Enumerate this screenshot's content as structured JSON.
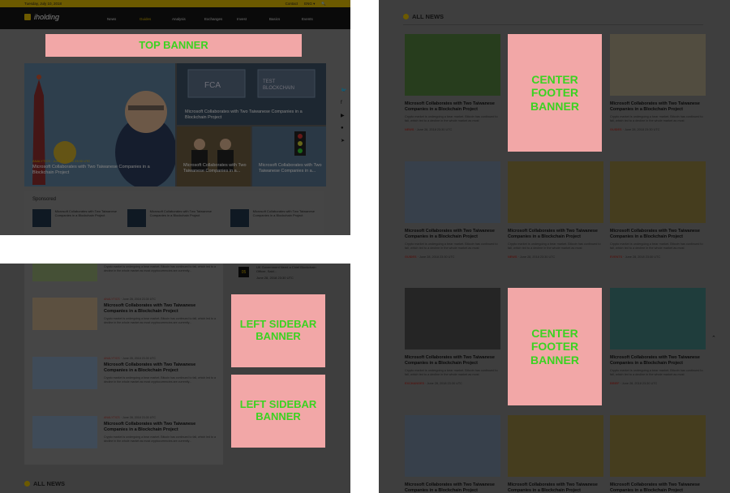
{
  "topbar": {
    "date": "Tuesday, July 10, 2018",
    "links": [
      "Contact",
      "ENG ▾",
      "🔍"
    ]
  },
  "logo": {
    "text": "iholding"
  },
  "nav": {
    "items": [
      "News",
      "Guides",
      "Analysis",
      "Exchanges",
      "Invest",
      "Basics",
      "Events"
    ],
    "active": "Guides"
  },
  "banners": {
    "top": "TOP BANNER",
    "left_sidebar": "LEFT SIDEBAR BANNER",
    "center_footer": "CENTER FOOTER BANNER"
  },
  "hero": {
    "main": {
      "category": "ANALYTICS",
      "date": "June 28, 2018 23:30 UTC",
      "title": "Microsoft Collaborates with Two Taiwanese Companies in a Blockchain Project"
    },
    "top_right": {
      "title": "Microsoft Collaborates with Two Taiwanese Companies in a Blockchain Project"
    },
    "bottom_mid": {
      "title": "Microsoft Collaborates with Two Taiwanese Companies in a..."
    },
    "bottom_right": {
      "title": "Microsoft Collaborates with Two Taiwanese Companies in a..."
    }
  },
  "sponsored": {
    "title": "Sponsored",
    "items": [
      "Microsoft Collaborates with Two Taiwanese Companies in a Blockchain Project",
      "Microsoft Collaborates with Two Taiwanese Companies in a Blockchain Project",
      "Microsoft Collaborates with Two Taiwanese Companies in a Blockchain Project"
    ]
  },
  "social_icons": [
    "twitter-icon",
    "facebook-icon",
    "youtube-icon",
    "reddit-icon",
    "telegram-icon"
  ],
  "left_list": {
    "top_excerpt": "Crypto market is undergoing a bear market. Bitcoin has continued to fall, which led to a decline in the whole market as most cryptocurrencies are currently...",
    "items": [
      {
        "category": "ANALYTICS",
        "date": "June 28, 2018 23:30 UTC",
        "title": "Microsoft Collaborates with Two Taiwanese Companies in a Blockchain Project",
        "excerpt": "Crypto market is undergoing a bear market. Bitcoin has continued to fall, which led to a decline in the whole market as most cryptocurrencies are currently..."
      },
      {
        "category": "ANALYTICS",
        "date": "June 28, 2018 23:30 UTC",
        "title": "Microsoft Collaborates with Two Taiwanese Companies in a Blockchain Project",
        "excerpt": "Crypto market is undergoing a bear market. Bitcoin has continued to fall, which led to a decline in the whole market as most cryptocurrencies are currently..."
      },
      {
        "category": "ANALYTICS",
        "date": "June 28, 2018 23:30 UTC",
        "title": "Microsoft Collaborates with Two Taiwanese Companies in a Blockchain Project",
        "excerpt": "Crypto market is undergoing a bear market. Bitcoin has continued to fall, which led to a decline in the whole market as most cryptocurrencies are currently..."
      }
    ],
    "rank": "05",
    "rank_title": "UK Government Need a Chief Blockchain Officer, Said...",
    "rank_date": "June 28, 2018 23:30 UTC"
  },
  "all_news": {
    "title": "ALL NEWS"
  },
  "grid": {
    "excerpt": "Crypto market is undergoing a bear market. Bitcoin has continued to fall, which led to a decline in the whole market as most",
    "title": "Microsoft Collaborates with Two Taiwanese Companies in a Blockchain Project",
    "date": "June 28, 2018 23:30 UTC",
    "cards": [
      {
        "category": "NEWS"
      },
      {
        "category": "GUIDES"
      },
      {
        "category": "GUIDES"
      },
      {
        "category": "NEWS"
      },
      {
        "category": "EVENTS"
      },
      {
        "category": "EXCHANGES"
      },
      {
        "category": "BRIEF"
      }
    ]
  }
}
